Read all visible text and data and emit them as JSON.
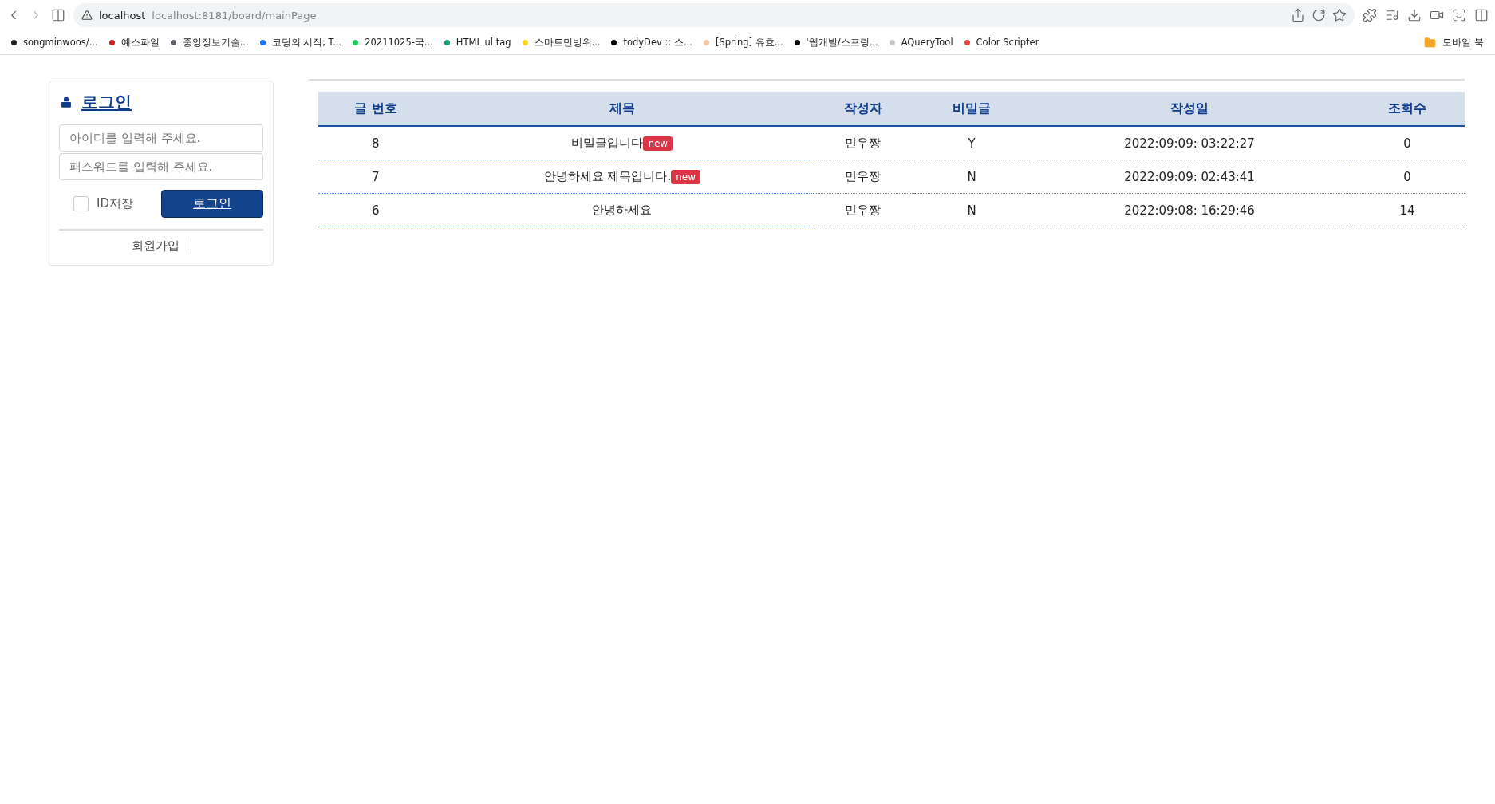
{
  "browser": {
    "site": "localhost",
    "url": "localhost:8181/board/mainPage"
  },
  "bookmarks": [
    {
      "label": "songminwoos/...",
      "color": "#202124"
    },
    {
      "label": "예스파일",
      "color": "#c5221f"
    },
    {
      "label": "중앙정보기술...",
      "color": "#5f6368"
    },
    {
      "label": "코딩의 시작, T...",
      "color": "#1a73e8"
    },
    {
      "label": "20211025-국...",
      "color": "#1ec95c"
    },
    {
      "label": "HTML ul tag",
      "color": "#0d9f6e"
    },
    {
      "label": "스마트민방위...",
      "color": "#f9d71c"
    },
    {
      "label": "todyDev :: 스...",
      "color": "#000000"
    },
    {
      "label": "[Spring] 유효...",
      "color": "#f5c6a5"
    },
    {
      "label": "'웹개발/스프링...",
      "color": "#000000"
    },
    {
      "label": "AQueryTool",
      "color": "#c8c8c8"
    },
    {
      "label": "Color Scripter",
      "color": "#e8453c"
    }
  ],
  "bookmark_folder": "모바일 북",
  "login": {
    "title": "로그인",
    "id_placeholder": "아이디를 입력해 주세요.",
    "pw_placeholder": "패스워드를 입력해 주세요.",
    "save_id": {
      "label": "ID저장",
      "checked": false
    },
    "button": "로그인",
    "signup": "회원가입"
  },
  "table": {
    "columns": [
      "글 번호",
      "제목",
      "작성자",
      "비밀글",
      "작성일",
      "조회수"
    ],
    "rows": [
      {
        "no": "8",
        "title": "비밀글입니다",
        "badge": "new",
        "author": "민우짱",
        "secret": "Y",
        "date": "2022:09:09: 03:22:27",
        "views": "0"
      },
      {
        "no": "7",
        "title": "안녕하세요 제목입니다.",
        "badge": "new",
        "author": "민우짱",
        "secret": "N",
        "date": "2022:09:09: 02:43:41",
        "views": "0"
      },
      {
        "no": "6",
        "title": "안녕하세요",
        "author": "민우짱",
        "secret": "N",
        "date": "2022:09:08: 16:29:46",
        "views": "14"
      }
    ]
  }
}
